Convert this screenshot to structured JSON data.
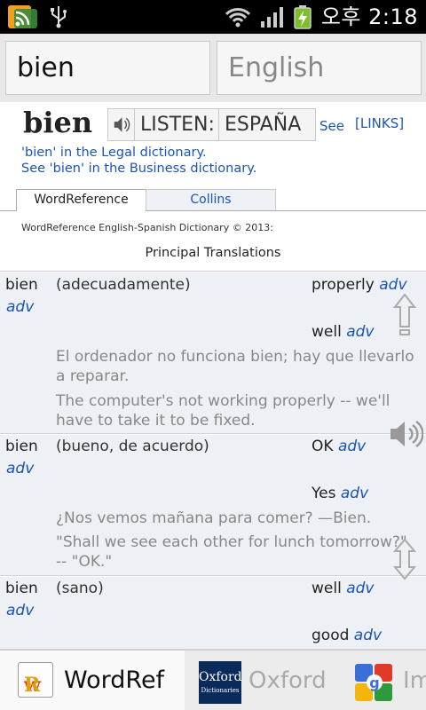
{
  "status_bar": {
    "time": "오후 2:18",
    "icons": [
      "rss-feed-icon",
      "usb-icon",
      "wifi-icon",
      "signal-icon",
      "battery-charging-icon"
    ]
  },
  "search": {
    "query": "bien",
    "language": "English"
  },
  "entry": {
    "headword": "bien",
    "listen_label": "LISTEN:",
    "listen_region": "ESPAÑA",
    "see_label": "See",
    "links_label": "[LINKS]",
    "legal_link": "'bien' in the Legal dictionary.",
    "business_link": "See 'bien' in the Business dictionary."
  },
  "tabs": [
    {
      "label": "WordReference",
      "active": true
    },
    {
      "label": "Collins",
      "active": false
    }
  ],
  "dictionary_credit": "WordReference English-Spanish Dictionary © 2013:",
  "section_title": "Principal Translations",
  "translations": [
    {
      "word": "bien",
      "pos": "adv",
      "sense": "(adecuadamente)",
      "targets": [
        {
          "word": "properly",
          "pos": "adv"
        },
        {
          "word": "well",
          "pos": "adv"
        }
      ],
      "example_lines": [
        "El ordenador no funciona bien; hay que llevarlo",
        "a reparar."
      ],
      "example_translation_lines": [
        "The computer's not working properly -- we'll",
        "have to take it to be fixed."
      ]
    },
    {
      "word": "bien",
      "pos": "adv",
      "sense": "(bueno, de acuerdo)",
      "targets": [
        {
          "word": "OK",
          "pos": "adv"
        },
        {
          "word": "Yes",
          "pos": "adv"
        }
      ],
      "example_lines": [
        "¿Nos vemos mañana para comer? —Bien."
      ],
      "example_translation_lines": [
        "\"Shall we see each other for lunch tomorrow?\"",
        "-- \"OK.\""
      ]
    },
    {
      "word": "bien",
      "pos": "adv",
      "sense": "(sano)",
      "targets": [
        {
          "word": "well",
          "pos": "adv"
        },
        {
          "word": "good",
          "pos": "adv"
        }
      ]
    }
  ],
  "bottom_tabs": [
    {
      "label": "WordRef",
      "logo_text": "wR",
      "active": true
    },
    {
      "label": "Oxford",
      "logo_line1": "Oxford",
      "logo_line2": "Dictionaries",
      "active": false
    },
    {
      "label": "Im",
      "active": false
    }
  ],
  "colors": {
    "link_blue": "#1a55b5",
    "row_background": "#edf0f5",
    "example_gray": "#888888"
  }
}
